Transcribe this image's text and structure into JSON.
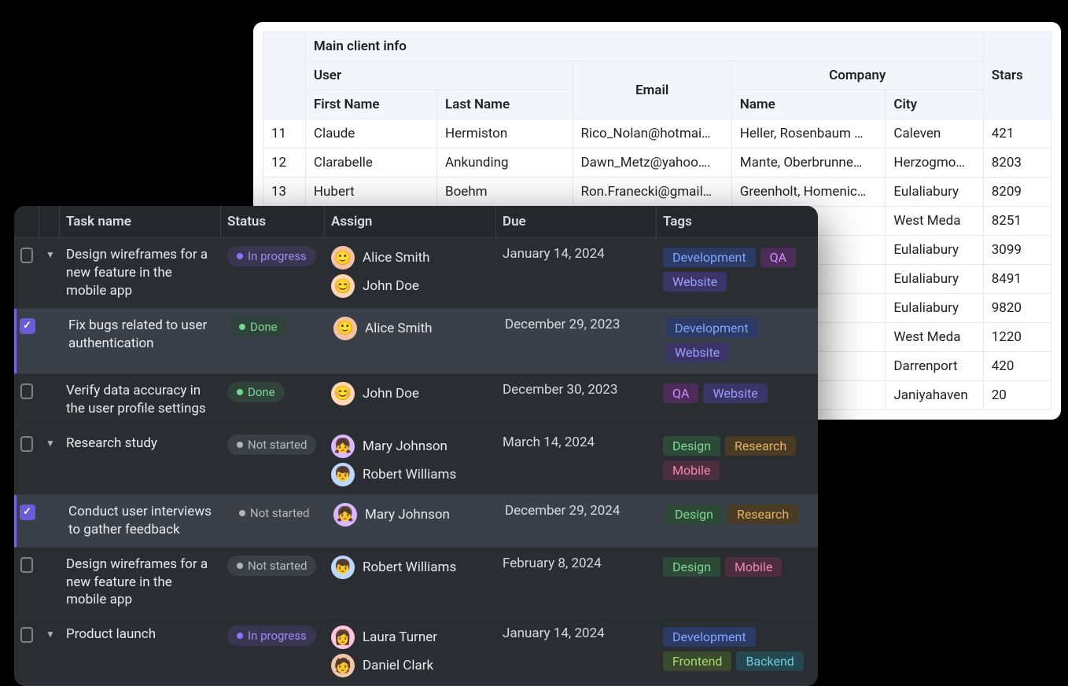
{
  "light_table": {
    "group_title": "Main client info",
    "headers": {
      "user": "User",
      "first_name": "First Name",
      "last_name": "Last Name",
      "email": "Email",
      "company": "Company",
      "company_name": "Name",
      "city": "City",
      "stars": "Stars"
    },
    "rows": [
      {
        "idx": "11",
        "first": "Claude",
        "last": "Hermiston",
        "email": "Rico_Nolan@hotmai…",
        "company": "Heller, Rosenbaum …",
        "city": "Caleven",
        "stars": "421"
      },
      {
        "idx": "12",
        "first": "Clarabelle",
        "last": "Ankunding",
        "email": "Dawn_Metz@yahoo….",
        "company": "Mante, Oberbrunne…",
        "city": "Herzogmo…",
        "stars": "8203"
      },
      {
        "idx": "13",
        "first": "Hubert",
        "last": "Boehm",
        "email": "Ron.Franecki@gmail…",
        "company": "Greenholt, Homenic…",
        "city": "Eulaliabury",
        "stars": "8209"
      },
      {
        "idx": "",
        "first": "",
        "last": "",
        "email": "",
        "company": "",
        "city": "West Meda",
        "stars": "8251"
      },
      {
        "idx": "",
        "first": "",
        "last": "",
        "email": "",
        "company": ".",
        "city": "Eulaliabury",
        "stars": "3099"
      },
      {
        "idx": "",
        "first": "",
        "last": "",
        "email": "",
        "company": "",
        "city": "Eulaliabury",
        "stars": "8491"
      },
      {
        "idx": "",
        "first": "",
        "last": "",
        "email": "",
        "company": "",
        "city": "Eulaliabury",
        "stars": "9820"
      },
      {
        "idx": "",
        "first": "",
        "last": "",
        "email": "",
        "company": "",
        "city": "West Meda",
        "stars": "1220"
      },
      {
        "idx": "",
        "first": "",
        "last": "",
        "email": "",
        "company": "",
        "city": "Darrenport",
        "stars": "420"
      },
      {
        "idx": "",
        "first": "",
        "last": "",
        "email": "",
        "company": "",
        "city": "Janiyahaven",
        "stars": "20"
      }
    ]
  },
  "dark_table": {
    "headers": {
      "task": "Task name",
      "status": "Status",
      "assign": "Assign",
      "due": "Due",
      "tags": "Tags"
    },
    "status_labels": {
      "in_progress": "In progress",
      "done": "Done",
      "not_started": "Not started"
    },
    "tag_labels": {
      "development": "Development",
      "qa": "QA",
      "website": "Website",
      "design": "Design",
      "research": "Research",
      "mobile": "Mobile",
      "frontend": "Frontend",
      "backend": "Backend"
    },
    "rows": [
      {
        "checked": false,
        "caret": true,
        "task": "Design wireframes for a new feature in the mobile app",
        "status": "in_progress",
        "assignees": [
          {
            "name": "Alice Smith",
            "av": 1
          },
          {
            "name": "John Doe",
            "av": 2
          }
        ],
        "due": "January 14, 2024",
        "tags": [
          "development",
          "qa",
          "website"
        ]
      },
      {
        "checked": true,
        "caret": false,
        "task": "Fix bugs related to user authentication",
        "status": "done",
        "assignees": [
          {
            "name": "Alice Smith",
            "av": 1
          }
        ],
        "due": "December 29, 2023",
        "tags": [
          "development",
          "website"
        ]
      },
      {
        "checked": false,
        "caret": false,
        "task": "Verify data accuracy in the user profile settings",
        "status": "done",
        "assignees": [
          {
            "name": "John Doe",
            "av": 2
          }
        ],
        "due": "December 30, 2023",
        "tags": [
          "qa",
          "website"
        ]
      },
      {
        "checked": false,
        "caret": true,
        "task": "Research study",
        "status": "not_started",
        "assignees": [
          {
            "name": "Mary Johnson",
            "av": 3
          },
          {
            "name": "Robert Williams",
            "av": 4
          }
        ],
        "due": "March 14, 2024",
        "tags": [
          "design",
          "research",
          "mobile"
        ]
      },
      {
        "checked": true,
        "caret": false,
        "task": "Conduct user interviews to gather feedback",
        "status": "not_started",
        "assignees": [
          {
            "name": "Mary Johnson",
            "av": 3
          }
        ],
        "due": "December 29, 2024",
        "tags": [
          "design",
          "research"
        ]
      },
      {
        "checked": false,
        "caret": false,
        "task": "Design wireframes for a new feature in the mobile app",
        "status": "not_started",
        "assignees": [
          {
            "name": "Robert Williams",
            "av": 4
          }
        ],
        "due": "February 8, 2024",
        "tags": [
          "design",
          "mobile"
        ]
      },
      {
        "checked": false,
        "caret": true,
        "task": "Product launch",
        "status": "in_progress",
        "assignees": [
          {
            "name": "Laura Turner",
            "av": 5
          },
          {
            "name": "Daniel Clark",
            "av": 6
          }
        ],
        "due": "January 14, 2024",
        "tags": [
          "development",
          "frontend",
          "backend"
        ]
      }
    ]
  }
}
